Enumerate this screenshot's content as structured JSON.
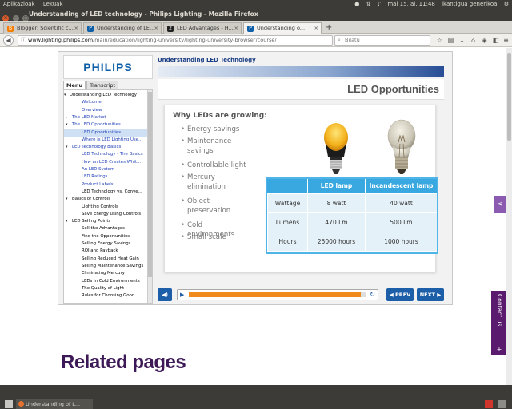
{
  "system_panel": {
    "apps_label": "Aplikazioak",
    "places_label": "Lekuak",
    "datetime": "mai 15, al. 11:48",
    "user": "ikantigua generikoa"
  },
  "window": {
    "title": "Understanding of LED technology - Philips Lighting - Mozilla Firefox"
  },
  "tabs": [
    {
      "label": "Blogger: Scientific c...",
      "favicon": "blogger-icon",
      "color": "#f57d00"
    },
    {
      "label": "Understanding of LE...",
      "favicon": "philips-icon",
      "color": "#0e5fa8"
    },
    {
      "label": "LED Advantages - H...",
      "favicon": "site-icon",
      "color": "#222222"
    },
    {
      "label": "Understanding o...",
      "favicon": "philips-icon",
      "color": "#0e5fa8"
    }
  ],
  "nav": {
    "url_host": "www.lighting.philips.com",
    "url_path": "/main/education/lighting-university/lighting-university-browser/course/",
    "search_placeholder": "Bilatu"
  },
  "course": {
    "logo": "PHILIPS",
    "title": "Understanding LED Technology",
    "menu_tab": "Menu",
    "transcript_tab": "Transcript",
    "menu_items": [
      {
        "label": "Understanding LED Technology",
        "level": 0,
        "arrow": "▾"
      },
      {
        "label": "Welcome",
        "level": 2,
        "link": true
      },
      {
        "label": "Overview",
        "level": 2,
        "link": true
      },
      {
        "label": "The LED Market",
        "level": 1,
        "link": true,
        "arrow": "▸"
      },
      {
        "label": "The LED Opportunities",
        "level": 1,
        "link": true,
        "arrow": "▾"
      },
      {
        "label": "LED Opportunities",
        "level": 2,
        "link": true,
        "selected": true
      },
      {
        "label": "Where is LED Lighting Use...",
        "level": 2,
        "link": true
      },
      {
        "label": "LED Technology Basics",
        "level": 1,
        "link": true,
        "arrow": "▾"
      },
      {
        "label": "LED Technology - The Basics",
        "level": 2,
        "link": true
      },
      {
        "label": "How an LED Creates Whit...",
        "level": 2,
        "link": true
      },
      {
        "label": "An LED System",
        "level": 2,
        "link": true
      },
      {
        "label": "LED Ratings",
        "level": 2,
        "link": true
      },
      {
        "label": "Product Labels",
        "level": 2,
        "link": true
      },
      {
        "label": "LED Technology vs. Conve...",
        "level": 2
      },
      {
        "label": "Basics of Controls",
        "level": 1,
        "arrow": "▾"
      },
      {
        "label": "Lighting Controls",
        "level": 2
      },
      {
        "label": "Save Energy using Controls",
        "level": 2
      },
      {
        "label": "LED Selling Points",
        "level": 1,
        "arrow": "▾"
      },
      {
        "label": "Sell the Advantages",
        "level": 2
      },
      {
        "label": "Find the Opportunities",
        "level": 2
      },
      {
        "label": "Selling Energy Savings",
        "level": 2
      },
      {
        "label": "ROI and Payback",
        "level": 2
      },
      {
        "label": "Selling Reduced Heat Gain",
        "level": 2
      },
      {
        "label": "Selling Maintenance Savings",
        "level": 2
      },
      {
        "label": "Eliminating Mercury",
        "level": 2
      },
      {
        "label": "LEDs in Cold Environments",
        "level": 2
      },
      {
        "label": "The Quality of Light",
        "level": 2
      },
      {
        "label": "Rules for Choosing Good ...",
        "level": 2
      }
    ],
    "slide": {
      "title": "LED Opportunities",
      "heading": "Why LEDs are growing:",
      "bullets": [
        {
          "text": "Energy savings"
        },
        {
          "text": "Maintenance savings"
        },
        {
          "text": "Controllable light"
        },
        {
          "text": "Mercury elimination"
        },
        {
          "text": "Object preservation"
        },
        {
          "text": "Cold environments"
        },
        {
          "text": "Small scale"
        }
      ],
      "table": {
        "headers": [
          "",
          "LED lamp",
          "Incandescent lamp"
        ],
        "rows": [
          [
            "Wattage",
            "8 watt",
            "40 watt"
          ],
          [
            "Lumens",
            "470 Lm",
            "500 Lm"
          ],
          [
            "Hours",
            "25000 hours",
            "1000 hours"
          ]
        ]
      }
    },
    "player": {
      "prev_label": "PREV",
      "next_label": "NEXT",
      "progress": 0.97
    }
  },
  "side": {
    "contact_label": "Contact us",
    "contact_plus": "+"
  },
  "related_heading": "Related pages",
  "taskbar": {
    "item_label": "Understanding of L..."
  },
  "colors": {
    "accent_blue": "#1d5ea8",
    "table_header": "#3aa8e0",
    "progress": "#f08a1c",
    "related": "#3d1a57"
  }
}
